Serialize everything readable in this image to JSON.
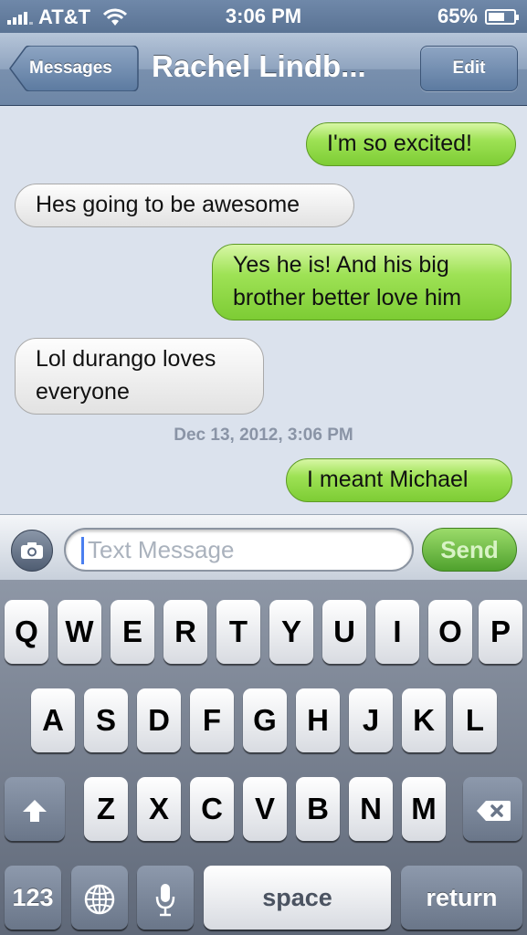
{
  "status_bar": {
    "carrier": "AT&T",
    "time": "3:06 PM",
    "battery_percent": "65%",
    "battery_level": 0.65,
    "signal_bars": 4,
    "wifi_icon": "wifi-icon",
    "color": "#6b84a5"
  },
  "nav": {
    "back_label": "Messages",
    "title": "Rachel Lindb...",
    "edit_label": "Edit"
  },
  "conversation": {
    "messages": [
      {
        "direction": "outgoing",
        "text": "I'm so excited!"
      },
      {
        "direction": "incoming",
        "text": "Hes going to be awesome"
      },
      {
        "direction": "outgoing",
        "text_lines": [
          "Yes he is! And his big",
          "brother better love him"
        ]
      },
      {
        "direction": "incoming",
        "text_lines": [
          "Lol durango loves",
          "everyone"
        ]
      },
      {
        "direction": "outgoing",
        "text": "I meant Michael"
      }
    ],
    "timestamp": "Dec 13, 2012, 3:06 PM",
    "outgoing_color": "#8fd84a",
    "incoming_color": "#f0f0f0"
  },
  "compose": {
    "camera_icon": "camera-icon",
    "placeholder": "Text Message",
    "value": "",
    "send_label": "Send"
  },
  "keyboard": {
    "row1": [
      "Q",
      "W",
      "E",
      "R",
      "T",
      "Y",
      "U",
      "I",
      "O",
      "P"
    ],
    "row2": [
      "A",
      "S",
      "D",
      "F",
      "G",
      "H",
      "J",
      "K",
      "L"
    ],
    "row3": [
      "Z",
      "X",
      "C",
      "V",
      "B",
      "N",
      "M"
    ],
    "shift_icon": "shift-icon",
    "delete_icon": "delete-icon",
    "numbers_label": "123",
    "globe_icon": "globe-icon",
    "mic_icon": "microphone-icon",
    "space_label": "space",
    "return_label": "return"
  }
}
